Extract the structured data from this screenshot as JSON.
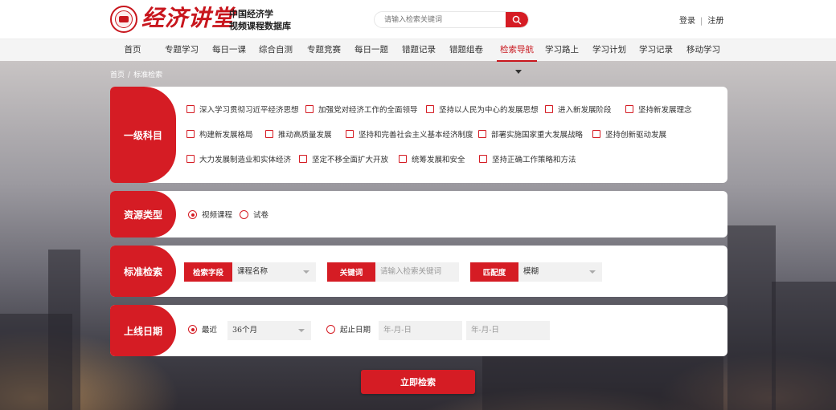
{
  "header": {
    "logo_text": "经济讲堂",
    "subtitle_line1": "中国经济学",
    "subtitle_line2": "视频课程数据库",
    "search_placeholder": "请输入检索关键词",
    "login": "登录",
    "separator": "|",
    "register": "注册"
  },
  "nav": {
    "items": [
      {
        "label": "首页"
      },
      {
        "label": "专题学习"
      },
      {
        "label": "每日一课"
      },
      {
        "label": "综合自测"
      },
      {
        "label": "专题竞赛"
      },
      {
        "label": "每日一题"
      },
      {
        "label": "错题记录"
      },
      {
        "label": "错题组卷"
      },
      {
        "label": "检索导航",
        "active": true
      },
      {
        "label": "学习路上"
      },
      {
        "label": "学习计划"
      },
      {
        "label": "学习记录"
      },
      {
        "label": "移动学习"
      }
    ]
  },
  "breadcrumb": {
    "home": "首页",
    "separator": "/",
    "current": "标准检索"
  },
  "subjects": {
    "label": "一级科目",
    "rows": [
      [
        "深入学习贯彻习近平经济思想",
        "加强党对经济工作的全面领导",
        "坚持以人民为中心的发展思想",
        "进入新发展阶段",
        "坚持新发展理念"
      ],
      [
        "构建新发展格局",
        "推动高质量发展",
        "坚持和完善社会主义基本经济制度",
        "部署实施国家重大发展战略",
        "坚持创新驱动发展"
      ],
      [
        "大力发展制造业和实体经济",
        "坚定不移全面扩大开放",
        "统筹发展和安全",
        "坚持正确工作策略和方法"
      ]
    ]
  },
  "resource_type": {
    "label": "资源类型",
    "options": [
      "视频课程",
      "试卷"
    ],
    "selected": "视频课程"
  },
  "standard_search": {
    "label": "标准检索",
    "field_label": "检索字段",
    "field_value": "课程名称",
    "keyword_label": "关键词",
    "keyword_placeholder": "请输入检索关键词",
    "match_label": "匹配度",
    "match_value": "模糊"
  },
  "online_date": {
    "label": "上线日期",
    "recent_label": "最近",
    "recent_value": "36个月",
    "range_label": "起止日期",
    "start_placeholder": "年-月-日",
    "end_placeholder": "年-月-日",
    "selected": "最近"
  },
  "submit_label": "立即检索",
  "colors": {
    "brand_red": "#d51c24",
    "nav_bg": "#f4f4f4",
    "field_bg": "#f1f1f1"
  }
}
